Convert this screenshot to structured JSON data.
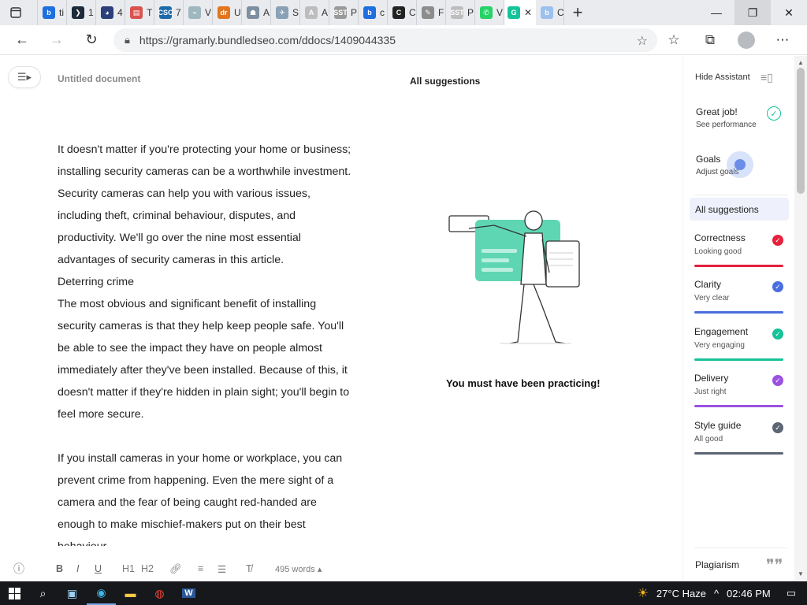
{
  "browser": {
    "tabs": [
      {
        "label": "",
        "fav_bg": "#1e6fe0",
        "fav_text": "b"
      },
      {
        "label": "ti",
        "fav_bg": "#1e6fe0",
        "fav_text": "b"
      },
      {
        "label": "1",
        "fav_bg": "#1c2a3a",
        "fav_text": "❯"
      },
      {
        "label": "4",
        "fav_bg": "#2b3f7a",
        "fav_text": "◕"
      },
      {
        "label": "T",
        "fav_bg": "#d9534f",
        "fav_text": "▤"
      },
      {
        "label": "7",
        "fav_bg": "#1d6aa8",
        "fav_text": "CSC"
      },
      {
        "label": "V",
        "fav_bg": "#9fb7bf",
        "fav_text": "⌁"
      },
      {
        "label": "U",
        "fav_bg": "#e2751d",
        "fav_text": "dr"
      },
      {
        "label": "A",
        "fav_bg": "#7d8fa1",
        "fav_text": "☗"
      },
      {
        "label": "S",
        "fav_bg": "#8aa0b5",
        "fav_text": "✈"
      },
      {
        "label": "A",
        "fav_bg": "#bdbdbd",
        "fav_text": "A"
      },
      {
        "label": "P",
        "fav_bg": "#9a9a9a",
        "fav_text": "SST"
      },
      {
        "label": "c",
        "fav_bg": "#1e6fe0",
        "fav_text": "b"
      },
      {
        "label": "C",
        "fav_bg": "#222222",
        "fav_text": "C"
      },
      {
        "label": "F",
        "fav_bg": "#8c8c8c",
        "fav_text": "✎"
      },
      {
        "label": "P",
        "fav_bg": "#bdbdbd",
        "fav_text": "SST"
      },
      {
        "label": "V",
        "fav_bg": "#25d366",
        "fav_text": "✆"
      }
    ],
    "active_tab": {
      "label": "G",
      "close": "✕"
    },
    "after_tab": {
      "label": "C",
      "fav_bg": "#9cc0ee",
      "fav_text": "b"
    },
    "new_tab": "+",
    "url": "https://gramarly.bundledseo.com/ddocs/1409044335"
  },
  "editor": {
    "doc_title": "Untitled document",
    "paragraphs": [
      {
        "text": "It doesn't matter if you're protecting your home or business; installing security cameras can be a worthwhile investment. Security cameras can help you with various issues, including theft, criminal behaviour, disputes, and productivity. We'll go over the nine most essential advantages of security cameras in this article.",
        "gap": false
      },
      {
        "text": "Deterring crime",
        "gap": false
      },
      {
        "text": "The most obvious and significant benefit of installing security cameras is that they help keep people safe. You'll be able to see the impact they have on people almost immediately after they've been installed. Because of this, it doesn't matter if they're hidden in plain sight; you'll begin to feel more secure.",
        "gap": false
      },
      {
        "text": "If you install cameras in your home or workplace, you can prevent crime from happening. Even the mere sight of a camera and the fear of being caught red-handed are enough to make mischief-makers put on their best behaviour.",
        "gap": true
      }
    ],
    "center_title": "All suggestions",
    "praise": "You must have been practicing!",
    "toolbar": {
      "bold": "B",
      "italic": "I",
      "underline": "U",
      "h1": "H1",
      "h2": "H2",
      "word_count": "495 words"
    }
  },
  "sidebar": {
    "hide_assistant": "Hide Assistant",
    "great_job": {
      "title": "Great job!",
      "subtitle": "See performance"
    },
    "goals": {
      "title": "Goals",
      "subtitle": "Adjust goals"
    },
    "all_suggestions": "All suggestions",
    "categories": [
      {
        "title": "Correctness",
        "subtitle": "Looking good",
        "color": "#e5213c"
      },
      {
        "title": "Clarity",
        "subtitle": "Very clear",
        "color": "#4a6ee0"
      },
      {
        "title": "Engagement",
        "subtitle": "Very engaging",
        "color": "#15c39a"
      },
      {
        "title": "Delivery",
        "subtitle": "Just right",
        "color": "#9b51e0"
      },
      {
        "title": "Style guide",
        "subtitle": "All good",
        "color": "#5b6573"
      }
    ],
    "plagiarism": "Plagiarism"
  },
  "taskbar": {
    "weather": "27°C  Haze",
    "time": "02:46 PM"
  }
}
